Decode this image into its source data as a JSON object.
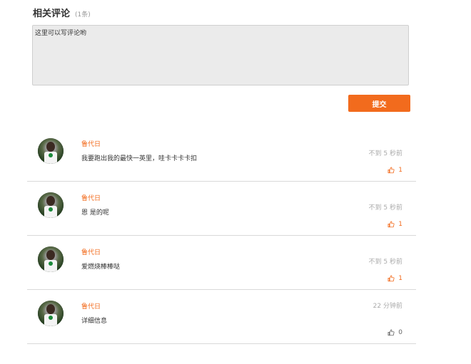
{
  "header": {
    "title": "相关评论",
    "count": "(1条)"
  },
  "comment_input": {
    "placeholder": "这里可以写评论哟"
  },
  "submit_label": "提交",
  "colors": {
    "accent": "#f26b1d",
    "muted": "#aaaaaa"
  },
  "comments": [
    {
      "author": "鲁代日",
      "text": "我要跑出我的最快一英里，哇卡卡卡卡扣",
      "time": "不到 5 秒前",
      "likes": "1",
      "liked": true,
      "avatar": "user-avatar"
    },
    {
      "author": "鲁代日",
      "text": "恩 是的呢",
      "time": "不到 5 秒前",
      "likes": "1",
      "liked": true,
      "avatar": "user-avatar"
    },
    {
      "author": "鲁代日",
      "text": "爱燃烧棒棒哒",
      "time": "不到 5 秒前",
      "likes": "1",
      "liked": true,
      "avatar": "user-avatar"
    },
    {
      "author": "鲁代日",
      "text": "详细信息",
      "time": "22 分钟前",
      "likes": "0",
      "liked": false,
      "avatar": "user-avatar"
    }
  ]
}
